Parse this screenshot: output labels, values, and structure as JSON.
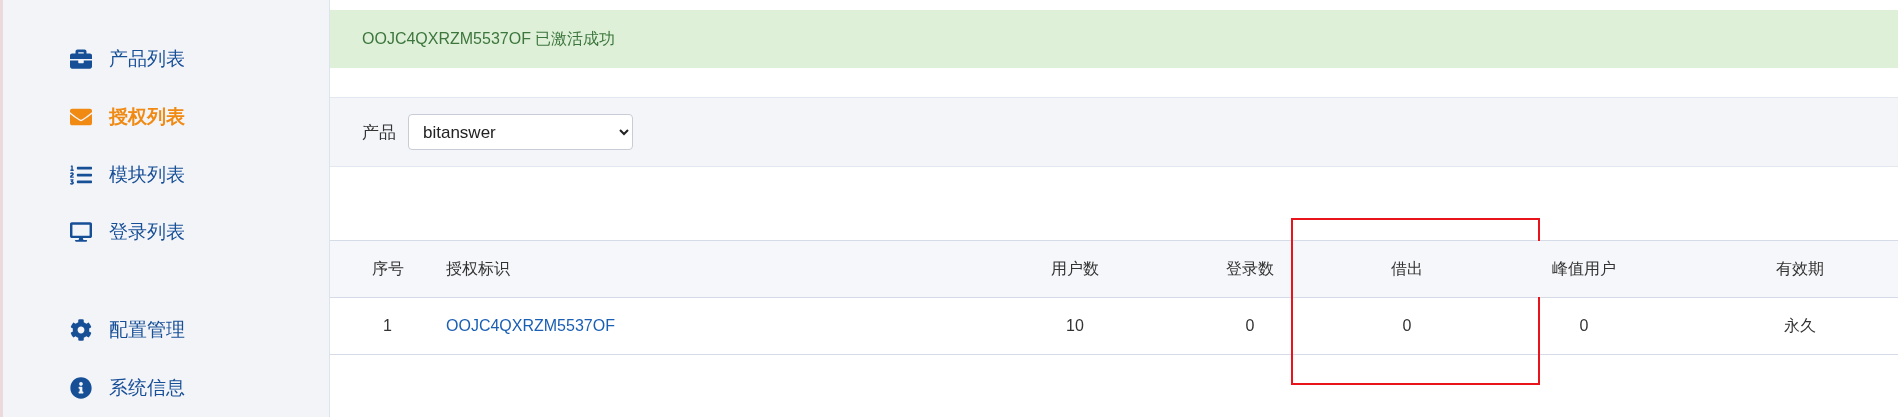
{
  "sidebar": {
    "groups": [
      {
        "items": [
          {
            "label": "产品列表",
            "selected": false
          },
          {
            "label": "授权列表",
            "selected": true
          },
          {
            "label": "模块列表",
            "selected": false
          },
          {
            "label": "登录列表",
            "selected": false
          }
        ]
      },
      {
        "items": [
          {
            "label": "配置管理",
            "selected": false
          },
          {
            "label": "系统信息",
            "selected": false
          }
        ]
      }
    ]
  },
  "alert": {
    "text": "OOJC4QXRZM5537OF 已激活成功"
  },
  "filter": {
    "label": "产品",
    "value": "bitanswer"
  },
  "table": {
    "columns": [
      {
        "label": "序号",
        "highlighted": false
      },
      {
        "label": "授权标识",
        "highlighted": false
      },
      {
        "label": "用户数",
        "highlighted": false
      },
      {
        "label": "登录数",
        "highlighted": false
      },
      {
        "label": "借出",
        "highlighted": true
      },
      {
        "label": "峰值用户",
        "highlighted": false
      },
      {
        "label": "有效期",
        "highlighted": false
      }
    ],
    "rows": [
      {
        "cells": [
          "1",
          "OOJC4QXRZM5537OF",
          "10",
          "0",
          "0",
          "0",
          "永久"
        ]
      }
    ]
  }
}
